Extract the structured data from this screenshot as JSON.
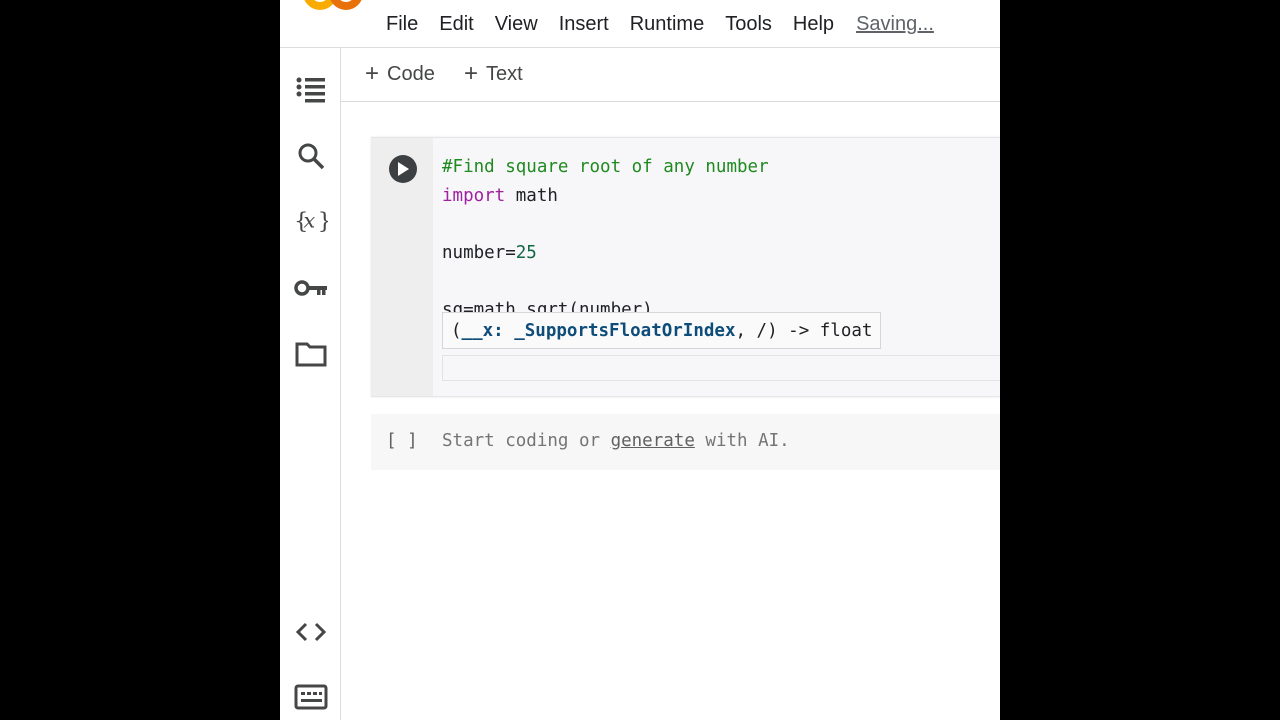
{
  "menu": {
    "items": [
      "File",
      "Edit",
      "View",
      "Insert",
      "Runtime",
      "Tools",
      "Help"
    ],
    "status": "Saving..."
  },
  "rail": {
    "icons": [
      "table-of-contents-icon",
      "search-icon",
      "variables-icon",
      "secrets-key-icon",
      "files-folder-icon",
      "code-snippets-icon",
      "command-palette-icon"
    ]
  },
  "toolbar": {
    "add_code_label": "Code",
    "add_text_label": "Text",
    "plus_glyph": "+"
  },
  "cell1": {
    "lines": {
      "comment": "#Find square root of any number",
      "import_kw": "import",
      "import_mod": " math",
      "assign_name": "number=",
      "assign_value": "25",
      "partial": "sq=math.sqrt(number)"
    },
    "tooltip": {
      "open": "(",
      "param": "__x: _SupportsFloatOrIndex",
      "rest": ", /) -> float"
    }
  },
  "cell2": {
    "bracket": "[ ]",
    "placeholder_before": "Start coding or ",
    "placeholder_link": "generate",
    "placeholder_after": " with AI."
  },
  "colors": {
    "logo_orange": "#F9AB00",
    "logo_dark_orange": "#E8710A",
    "comment": "#1f8a1f",
    "keyword": "#a020a0",
    "number": "#116644",
    "tooltip_param": "#0e4c7a"
  }
}
